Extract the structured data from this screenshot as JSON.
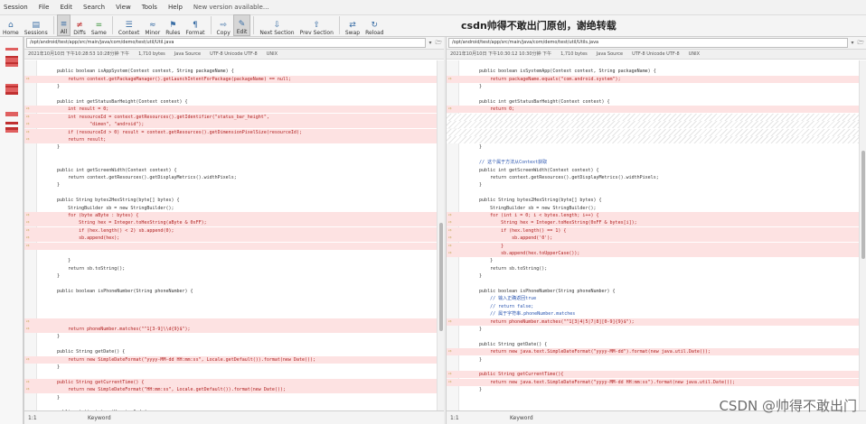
{
  "menu": {
    "items": [
      "Session",
      "File",
      "Edit",
      "Search",
      "View",
      "Tools",
      "Help"
    ],
    "update_notice": "New version available..."
  },
  "toolbar": {
    "buttons": [
      {
        "label": "Home",
        "icon": "home-icon"
      },
      {
        "label": "Sessions",
        "icon": "sessions-icon"
      },
      {
        "label": "All",
        "icon": "all-icon"
      },
      {
        "label": "Diffs",
        "icon": "diffs-icon"
      },
      {
        "label": "Same",
        "icon": "same-icon"
      },
      {
        "label": "Context",
        "icon": "context-icon"
      },
      {
        "label": "Minor",
        "icon": "minor-icon"
      },
      {
        "label": "Rules",
        "icon": "rules-icon"
      },
      {
        "label": "Format",
        "icon": "format-icon"
      },
      {
        "label": "Copy",
        "icon": "copy-icon"
      },
      {
        "label": "Edit",
        "icon": "edit-icon"
      },
      {
        "label": "Next Section",
        "icon": "next-section-icon"
      },
      {
        "label": "Prev Section",
        "icon": "prev-section-icon"
      },
      {
        "label": "Swap",
        "icon": "swap-icon"
      },
      {
        "label": "Reload",
        "icon": "reload-icon"
      }
    ]
  },
  "watermark_top": "csdn帅得不敢出门原创，谢绝转载",
  "left": {
    "path": "/opt/android/test/app/src/main/java/com/demo/test/util/Util.java",
    "info": [
      "2021年10月10日 下午10:28:53  10:28分钟 下午",
      "1,710 bytes",
      "Java Source",
      "UTF-8 Unicode UTF-8",
      "UNIX"
    ],
    "position": "1:1",
    "keyword": "Keyword",
    "lines": [
      {
        "t": "",
        "s": "eq"
      },
      {
        "t": "    public boolean isAppSystem(Context context, String packageName) {",
        "s": "eq"
      },
      {
        "t": "        return context.getPackageManager().getLaunchIntentForPackage(packageName) == null;",
        "s": "chg"
      },
      {
        "t": "    }",
        "s": "eq"
      },
      {
        "t": "",
        "s": "eq"
      },
      {
        "t": "    public int getStatusBarHeight(Context context) {",
        "s": "eq"
      },
      {
        "t": "        int result = 0;",
        "s": "chg"
      },
      {
        "t": "        int resourceId = context.getResources().getIdentifier(\"status_bar_height\",",
        "s": "chg"
      },
      {
        "t": "                \"dimen\", \"android\");",
        "s": "chg"
      },
      {
        "t": "        if (resourceId > 0) result = context.getResources().getDimensionPixelSize(resourceId);",
        "s": "chg"
      },
      {
        "t": "        return result;",
        "s": "chg"
      },
      {
        "t": "    }",
        "s": "eq"
      },
      {
        "t": "",
        "s": "eq"
      },
      {
        "t": "",
        "s": "eq"
      },
      {
        "t": "    public int getScreenWidth(Context context) {",
        "s": "eq"
      },
      {
        "t": "        return context.getResources().getDisplayMetrics().widthPixels;",
        "s": "eq"
      },
      {
        "t": "    }",
        "s": "eq"
      },
      {
        "t": "",
        "s": "eq"
      },
      {
        "t": "    public String bytes2HexString(byte[] bytes) {",
        "s": "eq"
      },
      {
        "t": "        StringBuilder sb = new StringBuilder();",
        "s": "eq"
      },
      {
        "t": "        for (byte aByte : bytes) {",
        "s": "chg"
      },
      {
        "t": "            String hex = Integer.toHexString(aByte & 0xFF);",
        "s": "chg"
      },
      {
        "t": "            if (hex.length() < 2) sb.append(0);",
        "s": "chg"
      },
      {
        "t": "            sb.append(hex);",
        "s": "chg"
      },
      {
        "t": "",
        "s": "chg"
      },
      {
        "t": "",
        "s": "eq"
      },
      {
        "t": "        }",
        "s": "eq"
      },
      {
        "t": "        return sb.toString();",
        "s": "eq"
      },
      {
        "t": "    }",
        "s": "eq"
      },
      {
        "t": "",
        "s": "eq"
      },
      {
        "t": "    public boolean isPhoneNumber(String phoneNumber) {",
        "s": "eq"
      },
      {
        "t": "",
        "s": "eq"
      },
      {
        "t": "",
        "s": "eq"
      },
      {
        "t": "",
        "s": "eq"
      },
      {
        "t": "",
        "s": "chg"
      },
      {
        "t": "        return phoneNumber.matches(\"^1[3-9]\\\\d{9}$\");",
        "s": "chg"
      },
      {
        "t": "    }",
        "s": "eq"
      },
      {
        "t": "",
        "s": "eq"
      },
      {
        "t": "    public String getDate() {",
        "s": "eq"
      },
      {
        "t": "        return new SimpleDateFormat(\"yyyy-MM-dd HH:mm:ss\", Locale.getDefault()).format(new Date());",
        "s": "chg"
      },
      {
        "t": "    }",
        "s": "eq"
      },
      {
        "t": "",
        "s": "eq"
      },
      {
        "t": "    public String getCurrentTime() {",
        "s": "chg"
      },
      {
        "t": "        return new SimpleDateFormat(\"HH:mm:ss\", Locale.getDefault()).format(new Date());",
        "s": "chg"
      },
      {
        "t": "    }",
        "s": "eq"
      },
      {
        "t": "",
        "s": "eq"
      },
      {
        "t": "    public static int getVersionCode(",
        "s": "eq"
      }
    ]
  },
  "right": {
    "path": "/opt/android/test/app/src/main/java/com/demo/test/util/Utils.java",
    "info": [
      "2021年10月10日 下午10:30:12  10:30分钟 下午",
      "1,710 bytes",
      "Java Source",
      "UTF-8 Unicode UTF-8",
      "UNIX"
    ],
    "position": "1:1",
    "keyword": "Keyword",
    "lines": [
      {
        "t": "",
        "s": "eq"
      },
      {
        "t": "    public boolean isSystemApp(Context context, String packageName) {",
        "s": "eq"
      },
      {
        "t": "        return packageName.equals(\"com.android.system\");",
        "s": "chg"
      },
      {
        "t": "    }",
        "s": "eq"
      },
      {
        "t": "",
        "s": "eq"
      },
      {
        "t": "    public int getStatusBarHeight(Context context) {",
        "s": "eq"
      },
      {
        "t": "        return 0;",
        "s": "chg"
      },
      {
        "t": "",
        "s": "hatch"
      },
      {
        "t": "",
        "s": "hatch"
      },
      {
        "t": "",
        "s": "hatch"
      },
      {
        "t": "",
        "s": "hatch"
      },
      {
        "t": "    }",
        "s": "eq"
      },
      {
        "t": "",
        "s": "eq"
      },
      {
        "t": "    // 这个属于方法从Context获取",
        "s": "cm"
      },
      {
        "t": "    public int getScreenWidth(Context context) {",
        "s": "eq"
      },
      {
        "t": "        return context.getResources().getDisplayMetrics().widthPixels;",
        "s": "eq"
      },
      {
        "t": "    }",
        "s": "eq"
      },
      {
        "t": "",
        "s": "eq"
      },
      {
        "t": "    public String bytes2HexString(byte[] bytes) {",
        "s": "eq"
      },
      {
        "t": "        StringBuilder sb = new StringBuilder();",
        "s": "eq"
      },
      {
        "t": "        for (int i = 0; i < bytes.length; i++) {",
        "s": "chg"
      },
      {
        "t": "            String hex = Integer.toHexString(0xFF & bytes[i]);",
        "s": "chg"
      },
      {
        "t": "            if (hex.length() == 1) {",
        "s": "chg"
      },
      {
        "t": "                sb.append('0');",
        "s": "chg"
      },
      {
        "t": "            }",
        "s": "chg"
      },
      {
        "t": "            sb.append(hex.toUpperCase());",
        "s": "chg"
      },
      {
        "t": "        }",
        "s": "eq"
      },
      {
        "t": "        return sb.toString();",
        "s": "eq"
      },
      {
        "t": "    }",
        "s": "eq"
      },
      {
        "t": "",
        "s": "eq"
      },
      {
        "t": "    public boolean isPhoneNumber(String phoneNumber) {",
        "s": "eq"
      },
      {
        "t": "        // 输入正确返回true",
        "s": "cm"
      },
      {
        "t": "        // return false;",
        "s": "cm"
      },
      {
        "t": "        // 属于字符串.phoneNumber.matches",
        "s": "cm"
      },
      {
        "t": "        return phoneNumber.matches(\"^1[3|4|5|7|8][0-9]{9}$\");",
        "s": "chg"
      },
      {
        "t": "    }",
        "s": "eq"
      },
      {
        "t": "",
        "s": "eq"
      },
      {
        "t": "    public String getDate() {",
        "s": "eq"
      },
      {
        "t": "        return new java.text.SimpleDateFormat(\"yyyy-MM-dd\").format(new java.util.Date());",
        "s": "chg"
      },
      {
        "t": "    }",
        "s": "eq"
      },
      {
        "t": "",
        "s": "eq"
      },
      {
        "t": "    public String getCurrentTime(){",
        "s": "chg"
      },
      {
        "t": "        return new java.text.SimpleDateFormat(\"yyyy-MM-dd HH:mm:ss\").format(new java.util.Date());",
        "s": "chg"
      },
      {
        "t": "    }",
        "s": "eq"
      },
      {
        "t": "",
        "s": "eq"
      },
      {
        "t": "",
        "s": "eq"
      }
    ]
  },
  "csdn_watermark": "CSDN @帅得不敢出门",
  "colors": {
    "changed_bg": "#fde2e2",
    "changed_text": "#b02020",
    "comment_text": "#2a55b0"
  }
}
